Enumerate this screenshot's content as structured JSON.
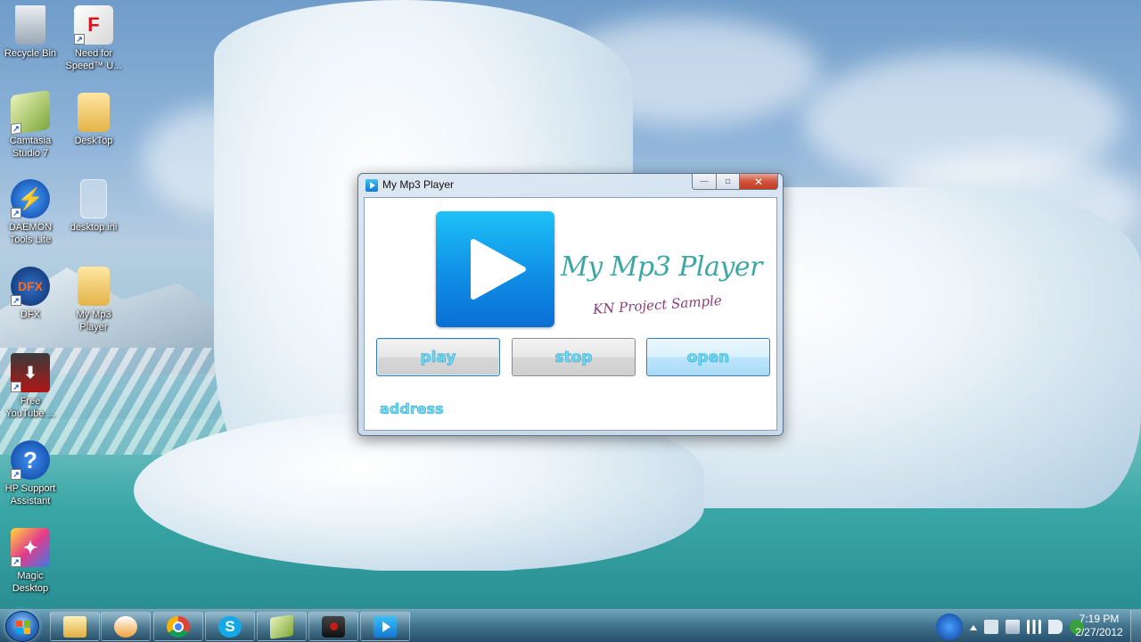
{
  "desktop": {
    "icons": [
      {
        "label": "Recycle Bin",
        "icon": "recycle-bin-icon"
      },
      {
        "label": "Need for Speed™ U...",
        "icon": "need-for-speed-icon"
      },
      {
        "label": "Camtasia Studio 7",
        "icon": "camtasia-icon"
      },
      {
        "label": "DeskTop",
        "icon": "folder-icon"
      },
      {
        "label": "DAEMON Tools Lite",
        "icon": "daemon-tools-icon"
      },
      {
        "label": "desktop.ini",
        "icon": "ini-file-icon"
      },
      {
        "label": "DFX",
        "icon": "dfx-icon"
      },
      {
        "label": "My Mp3 Player",
        "icon": "folder-icon"
      },
      {
        "label": "Free YouTube ...",
        "icon": "youtube-downloader-icon"
      },
      {
        "label": "HP Support Assistant",
        "icon": "help-icon"
      },
      {
        "label": "Magic Desktop",
        "icon": "magic-desktop-icon"
      }
    ]
  },
  "window": {
    "title": "My Mp3 Player",
    "caption": {
      "minimize": "—",
      "maximize": "▫",
      "close": "✕"
    },
    "logo": {
      "title": "My Mp3 Player",
      "subtitle": "KN Project Sample"
    },
    "buttons": {
      "play": "play",
      "stop": "stop",
      "open": "open"
    },
    "address_label": "address"
  },
  "taskbar": {
    "pinned": [
      "explorer-icon",
      "media-player-icon",
      "chrome-icon",
      "skype-icon",
      "camtasia-icon",
      "camera-icon",
      "mp3-player-icon"
    ],
    "clock": {
      "time": "7:19 PM",
      "date": "2/27/2012"
    }
  },
  "colors": {
    "accent": "#1a9fe8",
    "button_text": "#72d9f2",
    "brand_teal": "#3aa7a2",
    "brand_purple": "#8a3d76",
    "close_red": "#c23b22"
  }
}
